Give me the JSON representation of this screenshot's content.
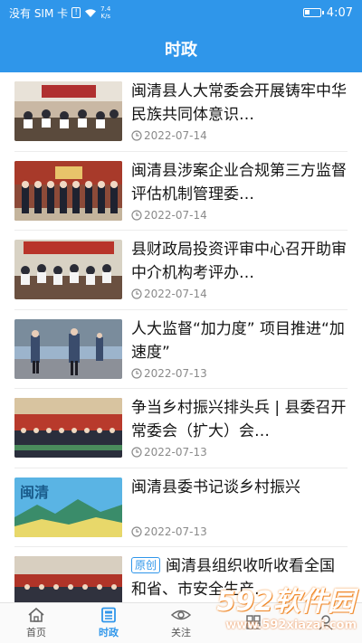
{
  "status_bar": {
    "carrier": "没有 SIM 卡",
    "net_speed_value": "7.4",
    "net_speed_unit": "K/s",
    "time": "4:07",
    "battery_level": 0.35
  },
  "header": {
    "title": "时政"
  },
  "news": [
    {
      "title": "闽清县人大常委会开展铸牢中华民族共同体意识…",
      "date": "2022-07-14",
      "tag": ""
    },
    {
      "title": "闽清县涉案企业合规第三方监督评估机制管理委…",
      "date": "2022-07-14",
      "tag": ""
    },
    {
      "title": "县财政局投资评审中心召开助审中介机构考评办…",
      "date": "2022-07-14",
      "tag": ""
    },
    {
      "title": "人大监督“加力度” 项目推进“加速度”",
      "date": "2022-07-13",
      "tag": ""
    },
    {
      "title": "争当乡村振兴排头兵 | 县委召开常委会（扩大）会…",
      "date": "2022-07-13",
      "tag": ""
    },
    {
      "title": "闽清县委书记谈乡村振兴",
      "date": "2022-07-13",
      "tag": ""
    },
    {
      "title": "闽清县组织收听收看全国和省、市安全生产…",
      "date": "",
      "tag": "原创"
    }
  ],
  "thumb_caption": "闽清",
  "tabs": [
    {
      "label": "首页",
      "icon": "home-icon",
      "active": false
    },
    {
      "label": "时政",
      "icon": "news-icon",
      "active": true
    },
    {
      "label": "关注",
      "icon": "eye-icon",
      "active": false
    },
    {
      "label": "",
      "icon": "grid-icon",
      "active": false
    },
    {
      "label": "",
      "icon": "user-icon",
      "active": false
    }
  ],
  "watermark": {
    "logo": "592软件园",
    "url": "www.592xiazai.com"
  },
  "colors": {
    "brand": "#2f96ea",
    "date": "#8a8a8a",
    "watermark": "#e9782a"
  }
}
